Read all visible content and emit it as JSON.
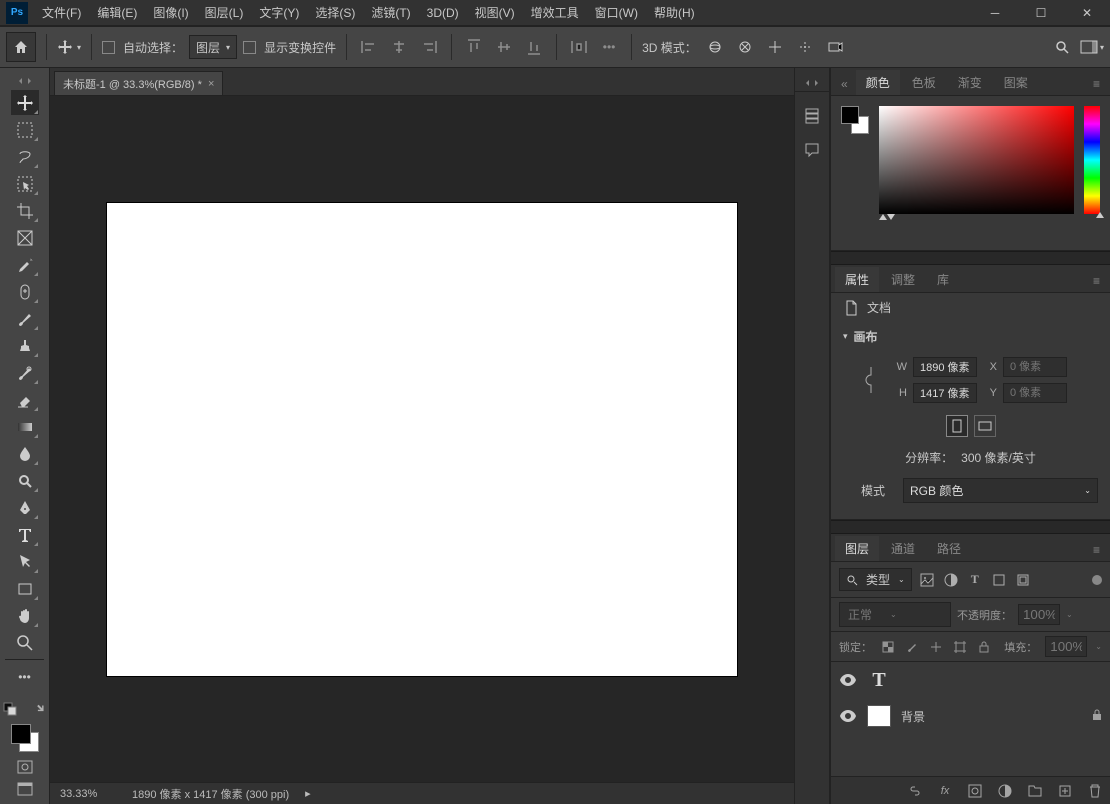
{
  "menubar": {
    "items": [
      "文件(F)",
      "编辑(E)",
      "图像(I)",
      "图层(L)",
      "文字(Y)",
      "选择(S)",
      "滤镜(T)",
      "3D(D)",
      "视图(V)",
      "增效工具",
      "窗口(W)",
      "帮助(H)"
    ]
  },
  "options": {
    "auto_select_label": "自动选择：",
    "target_dropdown": "图层",
    "show_transform_label": "显示变换控件",
    "mode3d_label": "3D 模式："
  },
  "doc": {
    "tab_title": "未标题-1 @ 33.3%(RGB/8) *"
  },
  "status": {
    "zoom": "33.33%",
    "dims": "1890 像素 x 1417 像素 (300 ppi)"
  },
  "color_panel": {
    "tabs": [
      "颜色",
      "色板",
      "渐变",
      "图案"
    ]
  },
  "props_panel": {
    "tabs": [
      "属性",
      "调整",
      "库"
    ],
    "doc_label": "文档",
    "canvas_label": "画布",
    "w_label": "W",
    "h_label": "H",
    "x_label": "X",
    "y_label": "Y",
    "w_value": "1890 像素",
    "h_value": "1417 像素",
    "x_placeholder": "0 像素",
    "y_placeholder": "0 像素",
    "resolution_label": "分辨率：",
    "resolution_value": "300 像素/英寸",
    "mode_label": "模式",
    "mode_value": "RGB 颜色"
  },
  "layers_panel": {
    "tabs": [
      "图层",
      "通道",
      "路径"
    ],
    "kind_label": "类型",
    "blend_mode": "正常",
    "opacity_label": "不透明度：",
    "opacity_value": "100%",
    "lock_label": "锁定：",
    "fill_label": "填充：",
    "fill_value": "100%",
    "layers": [
      {
        "name": "",
        "type": "text",
        "visible": true,
        "locked": false
      },
      {
        "name": "背景",
        "type": "raster",
        "visible": true,
        "locked": true
      }
    ]
  }
}
